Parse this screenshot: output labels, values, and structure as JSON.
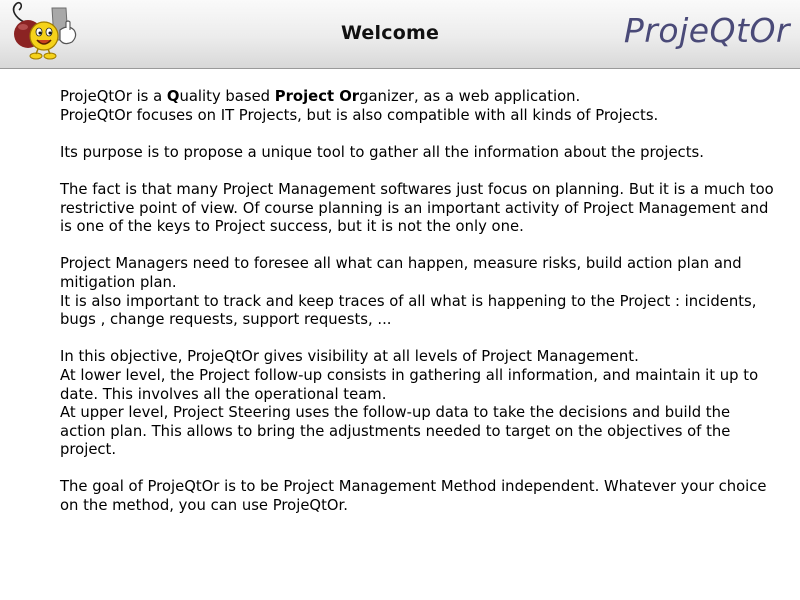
{
  "header": {
    "title": "Welcome",
    "brand": "ProjeQtOr"
  },
  "intro": {
    "line1": {
      "part1": "ProjeQtOr is a ",
      "q_bold": "Q",
      "part2": "uality based ",
      "project_bold": "Project Or",
      "part3": "ganizer, as a web application."
    },
    "line2": "ProjeQtOr focuses on IT Projects, but is also compatible with all kinds of Projects."
  },
  "paragraphs": {
    "purpose": "Its purpose is to propose a unique tool to gather all the information about the projects.",
    "fact": "The fact is that many Project Management softwares just focus on planning. But it is a much too restrictive point of view. Of course planning is an important activity of Project Management and is one of the keys to Project success, but it is not the only one.",
    "managers_1": "Project Managers need to foresee all what can happen, measure risks, build action plan and mitigation plan.",
    "managers_2": "It is also important to track and keep traces of all what is happening to the Project : incidents, bugs , change requests, support requests, ...",
    "objective_1": "In this objective, ProjeQtOr gives visibility at all levels of Project Management.",
    "objective_2": "At lower level, the Project follow-up consists in gathering all information, and maintain it up to date. This involves all the operational team.",
    "objective_3": "At upper level, Project Steering uses the follow-up data to take the decisions and build the action plan. This allows to bring the adjustments needed to target on the objectives of the project.",
    "goal": "The goal of ProjeQtOr is to be Project Management Method independent. Whatever your choice on the method, you can use ProjeQtOr."
  },
  "colors": {
    "brand": "#4a4a78",
    "header_bg": "#ececec",
    "logo_yellow": "#f5d21a",
    "logo_red": "#8b2323"
  },
  "icons": {
    "logo": "projeqtor-smiley-logo"
  }
}
